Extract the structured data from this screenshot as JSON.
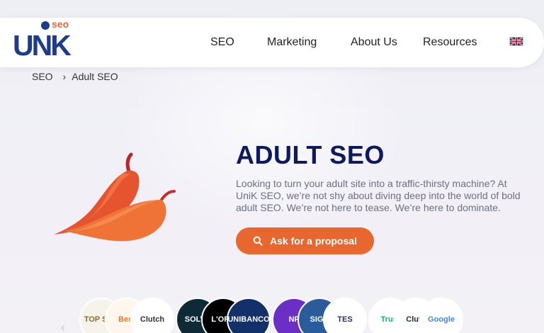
{
  "header": {
    "logo_text": "UNK",
    "logo_sub": "seo",
    "nav": [
      "SEO",
      "Marketing",
      "About Us",
      "Resources"
    ],
    "language_icon": "uk-flag-icon"
  },
  "breadcrumb": {
    "items": [
      "SEO",
      "Adult SEO"
    ],
    "separator": "›"
  },
  "hero": {
    "title": "ADULT SEO",
    "text": "Looking to turn your adult site into a traffic-thirsty machine? At UniK SEO, we’re not shy about diving deep into the world of bold adult SEO. We’re not here to tease. We’re here to dominate.",
    "cta_label": "Ask for a proposal",
    "illustration_icon": "chili-pepper-icon"
  },
  "badges": [
    {
      "label": "TOP SEO"
    },
    {
      "label": "Best"
    },
    {
      "label": "Clutch"
    },
    {
      "label": "SOLVE"
    },
    {
      "label": "L'ORÉ"
    },
    {
      "label": "UNIBANCO"
    },
    {
      "label": "NF"
    },
    {
      "label": "SIGN"
    },
    {
      "label": "TES"
    },
    {
      "label": "Trust"
    },
    {
      "label": "Clutc"
    },
    {
      "label": "Google"
    }
  ],
  "colors": {
    "brand_blue": "#1d3c8c",
    "accent_orange": "#e8672f",
    "title_navy": "#0d1a5e"
  }
}
